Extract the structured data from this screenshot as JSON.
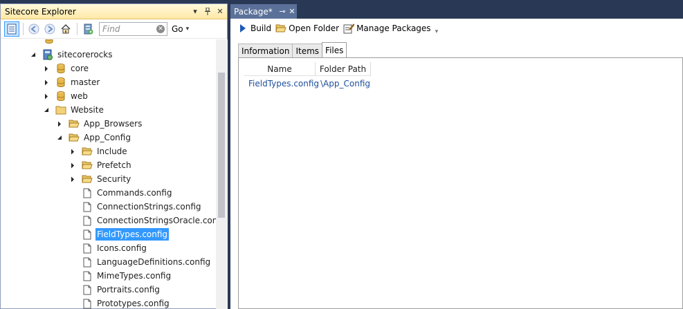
{
  "explorer": {
    "title": "Sitecore Explorer",
    "find_placeholder": "Find",
    "go_label": "Go",
    "tree": [
      {
        "label": "sitecorerocks",
        "indent": 0,
        "expander": "open",
        "icon": "site-icon",
        "selected": false
      },
      {
        "label": "core",
        "indent": 1,
        "expander": "closed",
        "icon": "database-icon",
        "selected": false
      },
      {
        "label": "master",
        "indent": 1,
        "expander": "closed",
        "icon": "database-icon",
        "selected": false
      },
      {
        "label": "web",
        "indent": 1,
        "expander": "closed",
        "icon": "database-icon",
        "selected": false
      },
      {
        "label": "Website",
        "indent": 1,
        "expander": "open",
        "icon": "folder-icon",
        "selected": false
      },
      {
        "label": "App_Browsers",
        "indent": 2,
        "expander": "closed",
        "icon": "open-folder-icon",
        "selected": false
      },
      {
        "label": "App_Config",
        "indent": 2,
        "expander": "open",
        "icon": "open-folder-icon",
        "selected": false
      },
      {
        "label": "Include",
        "indent": 3,
        "expander": "closed",
        "icon": "open-folder-icon",
        "selected": false
      },
      {
        "label": "Prefetch",
        "indent": 3,
        "expander": "closed",
        "icon": "open-folder-icon",
        "selected": false
      },
      {
        "label": "Security",
        "indent": 3,
        "expander": "closed",
        "icon": "open-folder-icon",
        "selected": false
      },
      {
        "label": "Commands.config",
        "indent": 3,
        "expander": "none",
        "icon": "file-icon",
        "selected": false
      },
      {
        "label": "ConnectionStrings.config",
        "indent": 3,
        "expander": "none",
        "icon": "file-icon",
        "selected": false
      },
      {
        "label": "ConnectionStringsOracle.config",
        "indent": 3,
        "expander": "none",
        "icon": "file-icon",
        "selected": false
      },
      {
        "label": "FieldTypes.config",
        "indent": 3,
        "expander": "none",
        "icon": "file-icon",
        "selected": true
      },
      {
        "label": "Icons.config",
        "indent": 3,
        "expander": "none",
        "icon": "file-icon",
        "selected": false
      },
      {
        "label": "LanguageDefinitions.config",
        "indent": 3,
        "expander": "none",
        "icon": "file-icon",
        "selected": false
      },
      {
        "label": "MimeTypes.config",
        "indent": 3,
        "expander": "none",
        "icon": "file-icon",
        "selected": false
      },
      {
        "label": "Portraits.config",
        "indent": 3,
        "expander": "none",
        "icon": "file-icon",
        "selected": false
      },
      {
        "label": "Prototypes.config",
        "indent": 3,
        "expander": "none",
        "icon": "file-icon",
        "selected": false
      }
    ]
  },
  "package": {
    "tab_label": "Package*",
    "toolbar": {
      "build": "Build",
      "open_folder": "Open Folder",
      "manage_packages": "Manage Packages"
    },
    "tabs": [
      "Information",
      "Items",
      "Files"
    ],
    "active_tab": "Files",
    "columns": {
      "name": "Name",
      "path": "Folder Path"
    },
    "files": [
      {
        "name": "FieldTypes.config",
        "path": "\\App_Config"
      }
    ]
  },
  "colors": {
    "ide_background": "#293955",
    "selection": "#3399ff",
    "link_text": "#1e4e9c"
  }
}
